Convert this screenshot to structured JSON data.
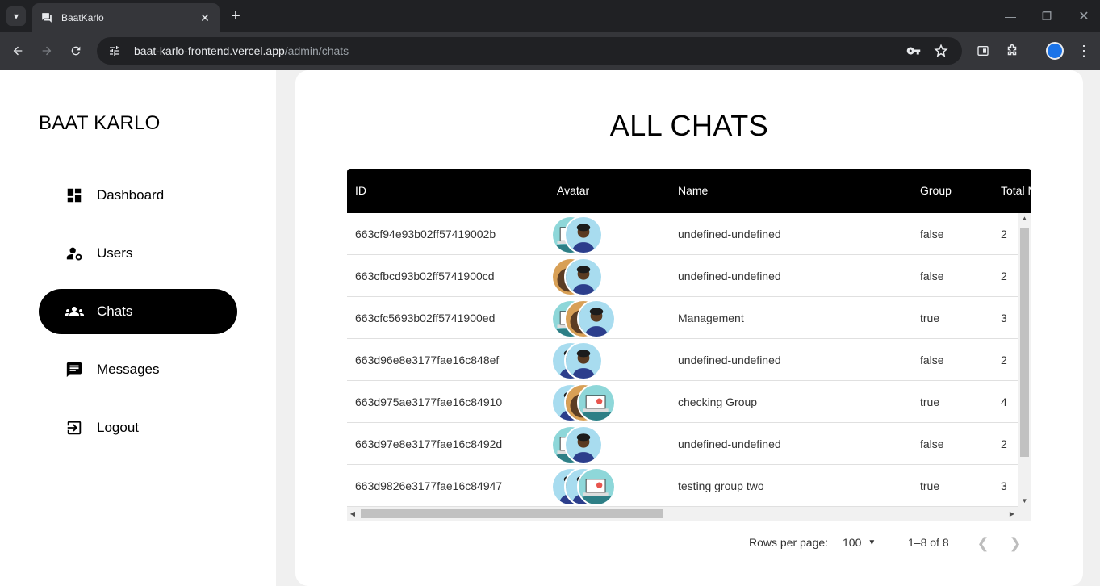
{
  "browser": {
    "tab_title": "BaatKarlo",
    "url_host": "baat-karlo-frontend.vercel.app",
    "url_path": "/admin/chats"
  },
  "sidebar": {
    "brand": "BAAT KARLO",
    "items": [
      {
        "label": "Dashboard",
        "icon": "dashboard-icon",
        "active": false
      },
      {
        "label": "Users",
        "icon": "manage-accounts-icon",
        "active": false
      },
      {
        "label": "Chats",
        "icon": "groups-icon",
        "active": true
      },
      {
        "label": "Messages",
        "icon": "message-icon",
        "active": false
      },
      {
        "label": "Logout",
        "icon": "logout-icon",
        "active": false
      }
    ]
  },
  "main": {
    "title": "ALL CHATS",
    "columns": [
      "ID",
      "Avatar",
      "Name",
      "Group",
      "Total M"
    ],
    "rows": [
      {
        "id": "663cf94e93b02ff57419002b",
        "avatars": [
          "laptop",
          "person"
        ],
        "name": "undefined-undefined",
        "group": "false",
        "total": "2"
      },
      {
        "id": "663cfbcd93b02ff5741900cd",
        "avatars": [
          "bear",
          "person"
        ],
        "name": "undefined-undefined",
        "group": "false",
        "total": "2"
      },
      {
        "id": "663cfc5693b02ff5741900ed",
        "avatars": [
          "laptop",
          "bear",
          "person"
        ],
        "name": "Management",
        "group": "true",
        "total": "3"
      },
      {
        "id": "663d96e8e3177fae16c848ef",
        "avatars": [
          "person",
          "person"
        ],
        "name": "undefined-undefined",
        "group": "false",
        "total": "2"
      },
      {
        "id": "663d975ae3177fae16c84910",
        "avatars": [
          "person",
          "bear",
          "laptop"
        ],
        "name": "checking Group",
        "group": "true",
        "total": "4"
      },
      {
        "id": "663d97e8e3177fae16c8492d",
        "avatars": [
          "laptop",
          "person"
        ],
        "name": "undefined-undefined",
        "group": "false",
        "total": "2"
      },
      {
        "id": "663d9826e3177fae16c84947",
        "avatars": [
          "person",
          "person",
          "laptop"
        ],
        "name": "testing group two",
        "group": "true",
        "total": "3"
      }
    ],
    "pagination": {
      "rows_per_page_label": "Rows per page:",
      "rows_per_page_value": "100",
      "range": "1–8 of 8"
    }
  }
}
